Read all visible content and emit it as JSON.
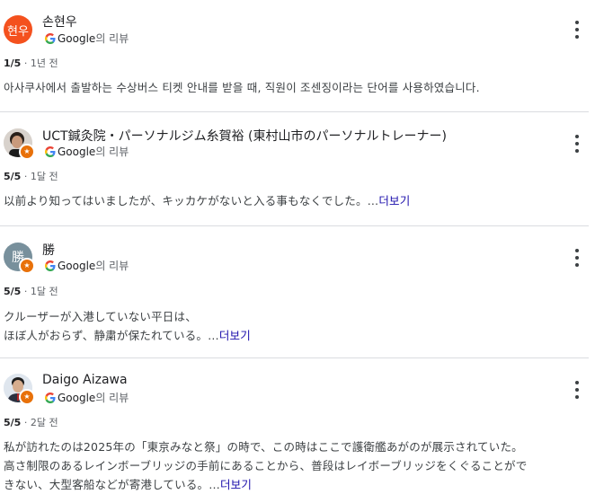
{
  "reviews": [
    {
      "avatar_text": "현우",
      "avatar_color": "#f4511e",
      "local_guide": false,
      "name": "손현우",
      "source": {
        "brand": "Google",
        "suffix": "의 리뷰"
      },
      "rating": "1/5",
      "separator": "·",
      "time": "1년 전",
      "lines": [
        "아사쿠사에서 출발하는 수상버스 티켓 안내를 받을 때, 직원이 조센징이라는 단어를 사용하였습니다."
      ],
      "more_label": ""
    },
    {
      "avatar_text": "",
      "avatar_color": "#3a2a22",
      "local_guide": true,
      "name": "UCT鍼灸院・パーソナルジム糸賀裕 (東村山市のパーソナルトレーナー)",
      "source": {
        "brand": "Google",
        "suffix": "의 리뷰"
      },
      "rating": "5/5",
      "separator": "·",
      "time": "1달 전",
      "lines": [
        "以前より知ってはいましたが、キッカケがないと入る事もなくでした。…"
      ],
      "more_label": "더보기"
    },
    {
      "avatar_text": "勝",
      "avatar_color": "#78909c",
      "local_guide": true,
      "name": "勝",
      "source": {
        "brand": "Google",
        "suffix": "의 리뷰"
      },
      "rating": "5/5",
      "separator": "·",
      "time": "1달 전",
      "lines": [
        "クルーザーが入港していない平日は、",
        "ほぼ人がおらず、静粛が保たれている。…"
      ],
      "more_label": "더보기"
    },
    {
      "avatar_text": "",
      "avatar_color": "#dfe6ee",
      "local_guide": true,
      "name": "Daigo Aizawa",
      "source": {
        "brand": "Google",
        "suffix": "의 리뷰"
      },
      "rating": "5/5",
      "separator": "·",
      "time": "2달 전",
      "lines": [
        "私が訪れたのは2025年の「東京みなと祭」の時で、この時はここで護衛艦あがのが展示されていた。",
        "高さ制限のあるレインボーブリッジの手前にあることから、普段はレイボーブリッジをくぐることがで",
        "きない、大型客船などが寄港している。…"
      ],
      "more_label": "더보기"
    }
  ]
}
